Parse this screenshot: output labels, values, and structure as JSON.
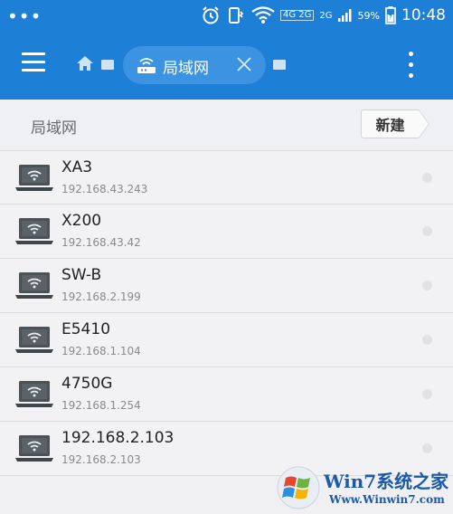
{
  "status_bar": {
    "dots": "•••",
    "network_badge": "4G 2G",
    "network_2g": "2G",
    "battery_percent": "59%",
    "time": "10:48"
  },
  "app_bar": {
    "menu_icon": "hamburger-menu-icon",
    "home_icon": "home-icon",
    "tab_label": "局域网",
    "tab_icon": "router-icon",
    "close_icon": "close-icon",
    "overflow_icon": "more-vertical-icon"
  },
  "section": {
    "title": "局域网",
    "new_button_label": "新建"
  },
  "devices": [
    {
      "name": "XA3",
      "ip": "192.168.43.243"
    },
    {
      "name": "X200",
      "ip": "192.168.43.42"
    },
    {
      "name": "SW-B",
      "ip": "192.168.2.199"
    },
    {
      "name": "E5410",
      "ip": "192.168.1.104"
    },
    {
      "name": "4750G",
      "ip": "192.168.1.254"
    },
    {
      "name": "192.168.2.103",
      "ip": "192.168.2.103"
    }
  ],
  "watermark": {
    "title": "Win7系统之家",
    "url": "Www.Winwin7.com"
  }
}
